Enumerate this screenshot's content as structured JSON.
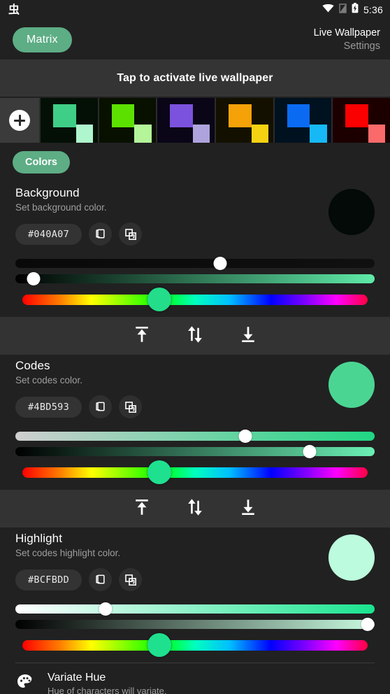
{
  "statusbar": {
    "notification_glyph": "虫",
    "time": "5:36",
    "icons": [
      "wifi-icon",
      "no-sim-icon",
      "battery-charging-icon"
    ]
  },
  "appbar": {
    "chip_label": "Matrix",
    "title": "Live Wallpaper",
    "subtitle": "Settings"
  },
  "banner": {
    "text": "Tap to activate live wallpaper"
  },
  "palette_strip": {
    "add_label": "+",
    "items": [
      {
        "name": "palette-green",
        "bg": "#041005",
        "main": "#3FCE86",
        "alt": "#AFF5CD"
      },
      {
        "name": "palette-lime",
        "bg": "#081000",
        "main": "#5CE000",
        "alt": "#B4F59A"
      },
      {
        "name": "palette-purple",
        "bg": "#0A0618",
        "main": "#7B52DE",
        "alt": "#AFA3DD"
      },
      {
        "name": "palette-orange",
        "bg": "#141000",
        "main": "#F5A208",
        "alt": "#F5D211"
      },
      {
        "name": "palette-blue",
        "bg": "#00111F",
        "main": "#0A6BF2",
        "alt": "#16B9F5"
      },
      {
        "name": "palette-red",
        "bg": "#1C0000",
        "main": "#FA0000",
        "alt": "#FA6A6A"
      }
    ]
  },
  "tabs": {
    "colors_label": "Colors"
  },
  "sections": [
    {
      "name": "background",
      "title": "Background",
      "subtitle": "Set background color.",
      "hex": "#040A07",
      "swatch": "#040A07",
      "copy_icon": "copy-icon",
      "paste_icon": "paste-icon",
      "sliders": {
        "lightness": {
          "pct": 57,
          "from": "#090909",
          "to": "#101010"
        },
        "saturation": {
          "pct": 5,
          "from": "#000000",
          "to": "#5FEBA8"
        },
        "hue": {
          "pct": 40,
          "thumb": "#23DD8A"
        }
      }
    },
    {
      "name": "codes",
      "title": "Codes",
      "subtitle": "Set codes color.",
      "hex": "#4BD593",
      "swatch": "#4BD593",
      "copy_icon": "copy-icon",
      "paste_icon": "paste-icon",
      "sliders": {
        "lightness": {
          "pct": 64,
          "from": "#CFCFCF",
          "to": "#1FD683"
        },
        "saturation": {
          "pct": 82,
          "from": "#000000",
          "to": "#6BF0B4"
        },
        "hue": {
          "pct": 40,
          "thumb": "#1FE08F"
        }
      }
    },
    {
      "name": "highlight",
      "title": "Highlight",
      "subtitle": "Set codes highlight color.",
      "hex": "#BCFBDD",
      "swatch": "#BCFBDD",
      "copy_icon": "copy-icon",
      "paste_icon": "paste-icon",
      "sliders": {
        "lightness": {
          "pct": 25,
          "from": "#FFFFFF",
          "to": "#19E48F"
        },
        "saturation": {
          "pct": 98,
          "from": "#000000",
          "to": "#C8FBE0"
        },
        "hue": {
          "pct": 40,
          "thumb": "#1FE08F"
        }
      }
    }
  ],
  "reorder": {
    "move_top_icon": "move-to-top-icon",
    "swap_icon": "swap-vertical-icon",
    "move_bottom_icon": "move-to-bottom-icon"
  },
  "variate_hue": {
    "icon": "palette-icon",
    "title": "Variate Hue",
    "subtitle": "Hue of characters will variate."
  },
  "colors": {
    "accent": "#5DAD85",
    "page_bg": "#212121",
    "divider_bg": "#333333",
    "banner_bg": "#343434"
  }
}
